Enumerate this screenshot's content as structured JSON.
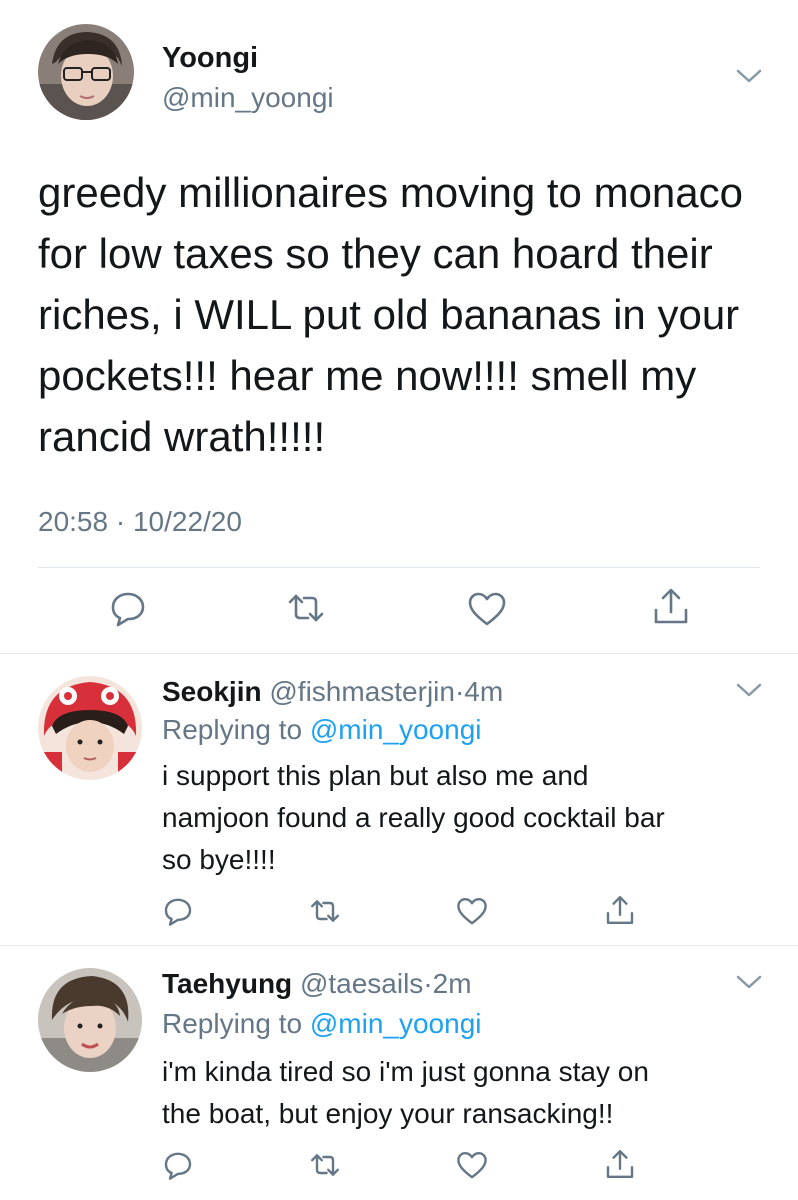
{
  "main_tweet": {
    "author_name": "Yoongi",
    "author_handle": "@min_yoongi",
    "text_lines": [
      "greedy millionaires moving to monaco",
      "for low taxes so they can hoard their",
      "riches, i WILL put old bananas in your",
      "pockets!!! hear me now!!!! smell my",
      "rancid wrath!!!!!"
    ],
    "timestamp": "20:58 · 10/22/20",
    "actions": [
      "reply-icon",
      "retweet-icon",
      "like-icon",
      "share-icon"
    ]
  },
  "replies": [
    {
      "author_name": "Seokjin",
      "author_handle": "@fishmasterjin",
      "separator": "·",
      "time": "4m",
      "replying_prefix": "Replying to ",
      "replying_to": "@min_yoongi",
      "text_lines": [
        "i support this plan but also me and",
        "namjoon found a really good cocktail bar",
        "so bye!!!!"
      ]
    },
    {
      "author_name": "Taehyung",
      "author_handle": "@taesails",
      "separator": "·",
      "time": "2m",
      "replying_prefix": "Replying to ",
      "replying_to": "@min_yoongi",
      "text_lines": [
        "i'm kinda tired so i'm just gonna stay on",
        "the boat, but enjoy your ransacking!!"
      ]
    }
  ],
  "colors": {
    "text": "#14171a",
    "secondary": "#657786",
    "link": "#1da1f2",
    "divider": "#e1e8ed"
  }
}
